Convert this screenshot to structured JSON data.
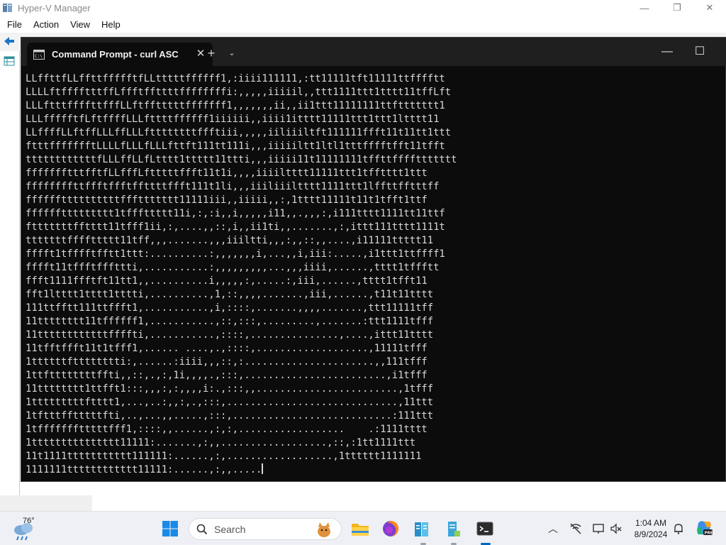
{
  "hyperv": {
    "title": "Hyper-V Manager",
    "menu": [
      "File",
      "Action",
      "View",
      "Help"
    ],
    "controls": {
      "minimize": "—",
      "maximize": "❐",
      "close": "✕"
    }
  },
  "terminal": {
    "tab_title": "Command Prompt - curl  ASC",
    "tab_close": "✕",
    "new_tab": "+",
    "dropdown": "⌄",
    "minimize": "—",
    "maximize": "☐",
    "lines": [
      "LLffttfLLffttffffftfLLtttttffffff1,:iiii111111,:tt11111tft11111ttfffftt",
      "LLLLftfffftttffLffftffttttffffffffi:,,,,,iiiiil,,ttt1111ttt1tttt11tffLft",
      "LLLftttffffttfffLLftfftttttfffffff1,,,,,,,ii,,ii1ttt11111111ttfttttttt1",
      "LLLffffftfLftffffLLLfttttffffff1iiiiii,,iiii1itttt11111ttt1ttt1ltttt11",
      "LLffffLLftffLLLffLLLfttttttttffftiii,,,,,iiliiiltft111111ffft11t11tt1ttt",
      "ftttffffffftLLLLfLLLfLLLfttft111tt111i,,,iiiiiltt1ltl1tttfffftfft11tfft",
      "ttttttttttttfLLLffLLfLtttt1ttttt11ttti,,,iiiii11t11111111tffttffffttttttt",
      "ffffffftttfftfLLfffLftttttffft11t1i,,,,iiiiltttt11111ttt1tfftttt1ttt",
      "ffffffffttffftffftffttttffft111t1li,,,iiiliiiltttt1111ttt1lffttfftttff",
      "ffffffttttttttttfffttttttt11111iii,,iiiii,,:,1tttt11111t11t1tfft1ttf",
      "ffffffttttttttt1tfffttttt11i,:,:i,,i,,,,,i11,,.,,,:,i111tttt1111tt11ttf",
      "ftttttttfftttt11tfff1ii,:,....,,::,i,,ii1ti,,.......,:,ittt111tttt1111t",
      "tttttttffffttttt11tff,,,.......,,,iiiltti,,,:,,::,,....,i11111ttttt11",
      "fffft1tfffftfftt1ttt:..........:,,,,,,,i,...,,i,iii:.....,i1ttt1ttffff1",
      "fffft11tffftfffttti,...........:,,,,,,,,,...,,,iiii,......,tttt1tffftt",
      "ffft1111ffftft11tt1,,..........i,,,,,:,.....:,iii,......,tttt1tfft11",
      "fft1ltttt1tttt1tttti,..........,1,::,,,,.......,iii,......,t11t11tttt",
      "111ttfftt111ttffft1,...........,i,::::,.......,,,,.......,ttt11111tff",
      "11tttttttt11tffffff1,...........,::,:::,.........,.......:ttt1111tfff",
      "11ttttttttttttffffti,...........,::::,...............,....,ittt11tttt",
      "11tfftffft11t1tfff1,...... ....,.,::::,...................,11111tfff",
      "1ttttttftttttttti:,......:iiii,,,::,:......................,,111tfff",
      "1ttfttttttttffti,,::,.,:,1i,,,,.,:::,........................,i1tfff",
      "11tttttttt1ttfft1:::,,,:,:,,,,i:.,:::,,........................,1tfff",
      "1tttttttttftttt1,...,..:,,:,.,:::,.............................,11ttt",
      "1tftttfftttttfti,..,...,,.....,:::,...........................:111ttt",
      "1tffffffftttttfff1,::::,,......,:,:,..................    .:1111tttt",
      "1ttttttttttttttt11111:.......,:,,..................,::,:1tt1111ttt",
      "11t1111ttttttttttt111111:......,:,..................,1tttttt1111111",
      "1111111tttttttttttt11111:......,:,,....."
    ]
  },
  "taskbar": {
    "weather_temp": "76°",
    "search_placeholder": "Search",
    "time": "1:04 AM",
    "date": "8/9/2024"
  }
}
